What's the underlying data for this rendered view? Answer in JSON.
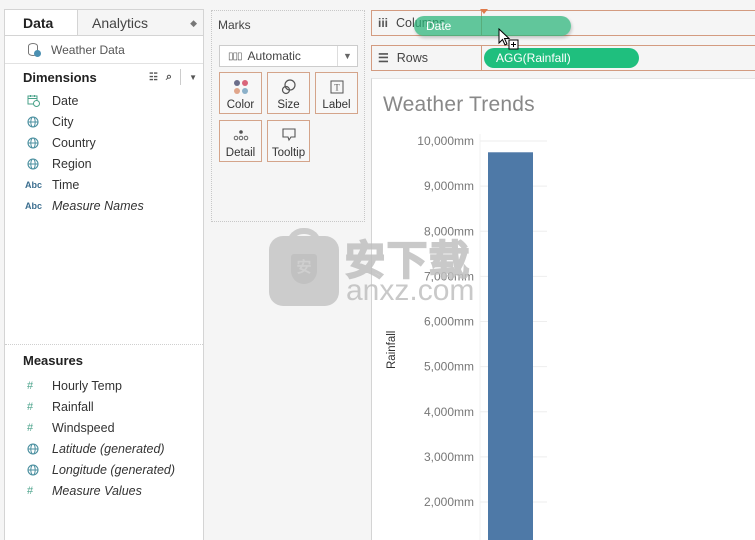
{
  "data_pane": {
    "tabs": [
      {
        "label": "Data",
        "active": true
      },
      {
        "label": "Analytics",
        "active": false
      }
    ],
    "datasource": {
      "name": "Weather Data",
      "icon": "database-check-icon"
    },
    "dimensions": {
      "title": "Dimensions",
      "fields": [
        {
          "label": "Date",
          "icon": "calendar-icon",
          "italic": false
        },
        {
          "label": "City",
          "icon": "globe-icon",
          "italic": false
        },
        {
          "label": "Country",
          "icon": "globe-icon",
          "italic": false
        },
        {
          "label": "Region",
          "icon": "globe-icon",
          "italic": false
        },
        {
          "label": "Time",
          "icon": "abc-icon",
          "italic": false
        },
        {
          "label": "Measure Names",
          "icon": "abc-icon",
          "italic": true
        }
      ]
    },
    "measures": {
      "title": "Measures",
      "fields": [
        {
          "label": "Hourly Temp",
          "icon": "hash-icon",
          "italic": false
        },
        {
          "label": "Rainfall",
          "icon": "hash-icon",
          "italic": false
        },
        {
          "label": "Windspeed",
          "icon": "hash-icon",
          "italic": false
        },
        {
          "label": "Latitude (generated)",
          "icon": "globe-icon",
          "italic": true
        },
        {
          "label": "Longitude (generated)",
          "icon": "globe-icon",
          "italic": true
        },
        {
          "label": "Measure Values",
          "icon": "hash-icon",
          "italic": true
        }
      ]
    }
  },
  "marks": {
    "title": "Marks",
    "mark_type": "Automatic",
    "buttons": [
      {
        "label": "Color",
        "icon": "color-dots-icon"
      },
      {
        "label": "Size",
        "icon": "size-icon"
      },
      {
        "label": "Label",
        "icon": "label-icon"
      },
      {
        "label": "Detail",
        "icon": "detail-icon"
      },
      {
        "label": "Tooltip",
        "icon": "tooltip-icon"
      }
    ],
    "color_dots": [
      "#6b6e8a",
      "#d9657a",
      "#e0a58a",
      "#8bb0c9"
    ]
  },
  "shelves": {
    "columns": {
      "label": "Columns",
      "dragging_pill": "Date"
    },
    "rows": {
      "label": "Rows",
      "pill": "AGG(Rainfall)"
    }
  },
  "colors": {
    "pill_green": "#1fbf7e",
    "bar_blue": "#4e79a7",
    "shelf_border": "#d39b80"
  },
  "view": {
    "title": "Weather Trends"
  },
  "chart_data": {
    "type": "bar",
    "title": "Weather Trends",
    "xlabel": "",
    "ylabel": "Rainfall",
    "categories": [
      ""
    ],
    "values": [
      9750
    ],
    "y_ticks": [
      2000,
      3000,
      4000,
      5000,
      6000,
      7000,
      8000,
      9000,
      10000
    ],
    "y_tick_labels": [
      "2,000mm",
      "3,000mm",
      "4,000mm",
      "5,000mm",
      "6,000mm",
      "7,000mm",
      "8,000mm",
      "9,000mm",
      "10,000mm"
    ],
    "y_unit": "mm",
    "ylim_visible": [
      1200,
      10250
    ],
    "grid": true,
    "legend": "none"
  },
  "watermark": {
    "cn": "安下载",
    "en": "anxz.com",
    "shield_char": "安"
  }
}
